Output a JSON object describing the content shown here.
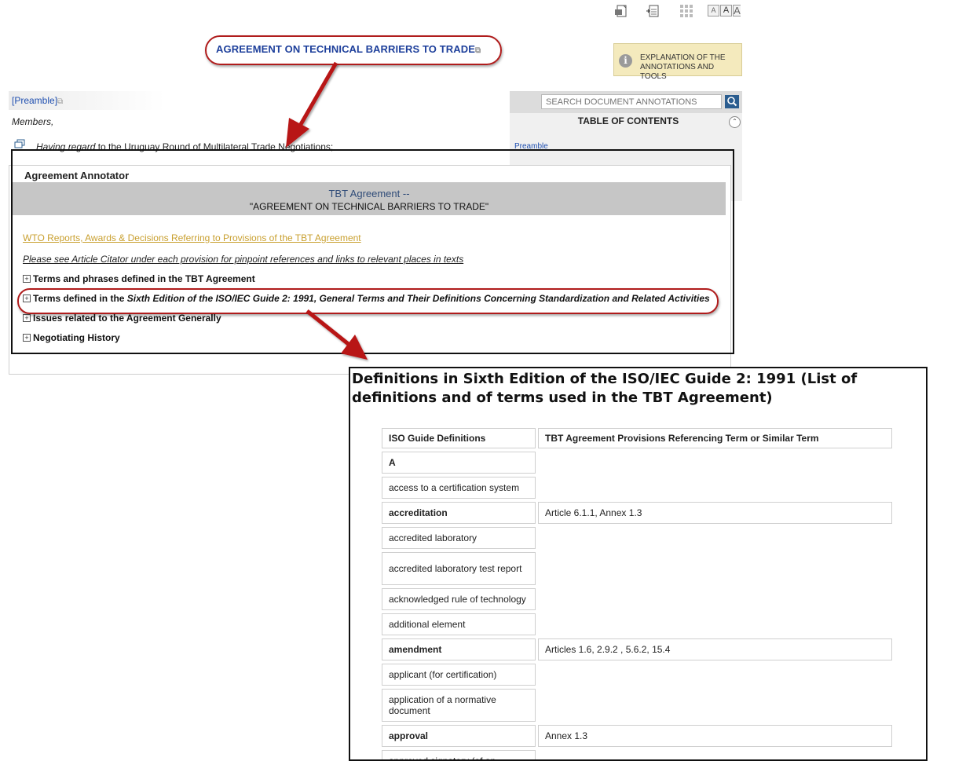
{
  "toolbar": {
    "icons": [
      "pdf-icon",
      "document-icon",
      "grid-icon",
      "font-size-icon"
    ],
    "font_size_labels": [
      "A",
      "A",
      "A"
    ]
  },
  "agreement_title": "AGREEMENT ON TECHNICAL BARRIERS TO TRADE",
  "explanation": {
    "line1": "EXPLANATION OF THE",
    "line2": "ANNOTATIONS AND TOOLS"
  },
  "document": {
    "preamble_link": "[Preamble]",
    "members": "Members,",
    "having_regard_italic": "Having regard",
    "having_regard_rest": " to the Uruguay Round of Multilateral Trade Negotiations;"
  },
  "toc": {
    "search_placeholder": "SEARCH DOCUMENT ANNOTATIONS",
    "title": "TABLE OF CONTENTS",
    "first_item": "Preamble"
  },
  "annotator": {
    "label": "Agreement Annotator",
    "header_line1": "TBT Agreement --",
    "header_line2": "\"AGREEMENT ON TECHNICAL BARRIERS TO TRADE\"",
    "wto_link": "WTO Reports, Awards & Decisions Referring to Provisions of the TBT Agreement",
    "citator_note": "Please see Article Citator under each provision for pinpoint references and links to relevant places in texts",
    "items": [
      {
        "label": "Terms and phrases defined in the TBT Agreement"
      },
      {
        "label_prefix": "Terms defined in the ",
        "label_italic": "Sixth Edition of the ISO/IEC Guide 2: 1991, General Terms and Their Definitions Concerning Standardization and Related Activities"
      },
      {
        "label": "Issues related to the Agreement Generally"
      },
      {
        "label": "Negotiating History"
      }
    ]
  },
  "definitions": {
    "title": "Definitions in Sixth Edition of the ISO/IEC Guide 2: 1991 (List of definitions and of terms used in the TBT Agreement)",
    "headers": [
      "ISO Guide Definitions",
      "TBT Agreement Provisions Referencing Term or Similar Term"
    ],
    "rows": [
      {
        "term": "A",
        "provisions": "",
        "bold": true
      },
      {
        "term": "access to a certification system",
        "provisions": "",
        "bold": false
      },
      {
        "term": "accreditation",
        "provisions": "Article 6.1.1, Annex 1.3",
        "bold": true
      },
      {
        "term": "accredited laboratory",
        "provisions": "",
        "bold": false
      },
      {
        "term": "accredited laboratory test report",
        "provisions": "",
        "bold": false
      },
      {
        "term": "acknowledged rule of technology",
        "provisions": "",
        "bold": false
      },
      {
        "term": "additional element",
        "provisions": "",
        "bold": false
      },
      {
        "term": "amendment",
        "provisions": "Articles 1.6, 2.9.2 , 5.6.2, 15.4",
        "bold": true
      },
      {
        "term": "applicant (for certification)",
        "provisions": "",
        "bold": false
      },
      {
        "term": "application of a normative document",
        "provisions": "",
        "bold": false
      },
      {
        "term": "approval",
        "provisions": "Annex 1.3",
        "bold": true
      },
      {
        "term": "approved signatory (of an accredited laboratory)",
        "provisions": "",
        "bold": false
      }
    ]
  }
}
